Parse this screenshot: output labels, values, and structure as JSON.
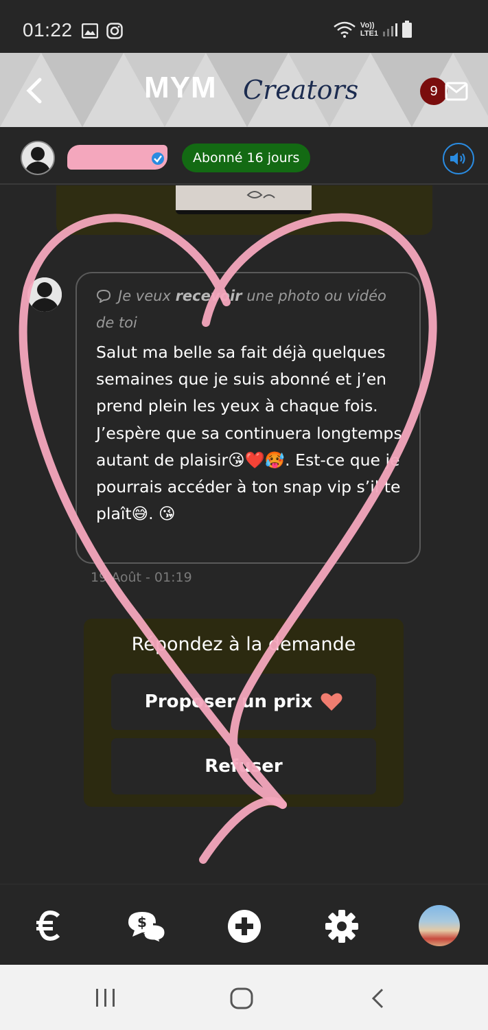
{
  "status_bar": {
    "time": "01:22",
    "network_label": "Vo))",
    "network_sub": "LTE1"
  },
  "header": {
    "logo_mym": "MYM",
    "logo_creators": "Creators",
    "notification_count": "9"
  },
  "subheader": {
    "subscription_label": "Abonné 16 jours"
  },
  "message": {
    "request_prefix": "Je veux ",
    "request_bold": "recevoir",
    "request_suffix": " une photo ou vidéo de toi",
    "text": "Salut ma belle sa fait déjà quelques semaines que je suis abonné et j’en prend plein les yeux à chaque fois. J’espère que sa continuera longtemps autant de plaisir😘❤️🥵. Est-ce que je pourrais accéder à ton snap vip s’il te plaît😅. 😘",
    "date": "19 Août - 01:19"
  },
  "respond": {
    "title": "Répondez à la demande",
    "propose_label": "Proposer un prix",
    "refuse_label": "Refuser"
  },
  "bottom_nav": {
    "items": [
      "euro-icon",
      "money-chat-icon",
      "plus-icon",
      "settings-icon",
      "profile-avatar"
    ]
  },
  "colors": {
    "background": "#262626",
    "accent_green": "#136a13",
    "badge_red": "#7a0d0d",
    "overlay_pink": "#f4a7bd",
    "sound_blue": "#2a8be0"
  }
}
